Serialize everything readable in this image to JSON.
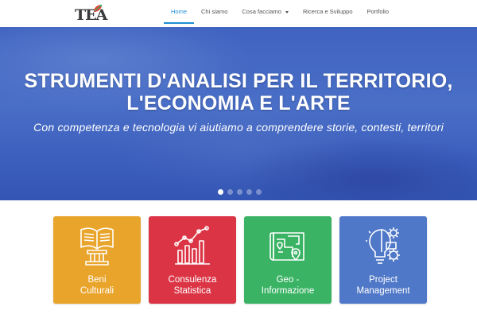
{
  "logo": {
    "text": "TEA"
  },
  "nav": {
    "items": [
      {
        "label": "Home",
        "active": true
      },
      {
        "label": "Chi siamo",
        "active": false
      },
      {
        "label": "Cosa facciamo",
        "active": false,
        "dropdown": true
      },
      {
        "label": "Ricerca e Sviluppo",
        "active": false
      },
      {
        "label": "Portfolio",
        "active": false
      }
    ]
  },
  "hero": {
    "title_line1": "STRUMENTI D'ANALISI PER IL TERRITORIO,",
    "title_line2": "L'ECONOMIA E L'ARTE",
    "subtitle": "Con competenza e tecnologia vi aiutiamo a comprendere storie, contesti, territori",
    "slides_count": 5,
    "active_slide": 1
  },
  "cards": [
    {
      "line1": "Beni",
      "line2": "Culturali",
      "icon": "book-column-icon",
      "color": "#e9a42b"
    },
    {
      "line1": "Consulenza",
      "line2": "Statistica",
      "icon": "bar-chart-icon",
      "color": "#db3545"
    },
    {
      "line1": "Geo -",
      "line2": "Informazione",
      "icon": "map-icon",
      "color": "#3ab364"
    },
    {
      "line1": "Project",
      "line2": "Management",
      "icon": "lightbulb-gear-icon",
      "color": "#5078c8"
    }
  ]
}
